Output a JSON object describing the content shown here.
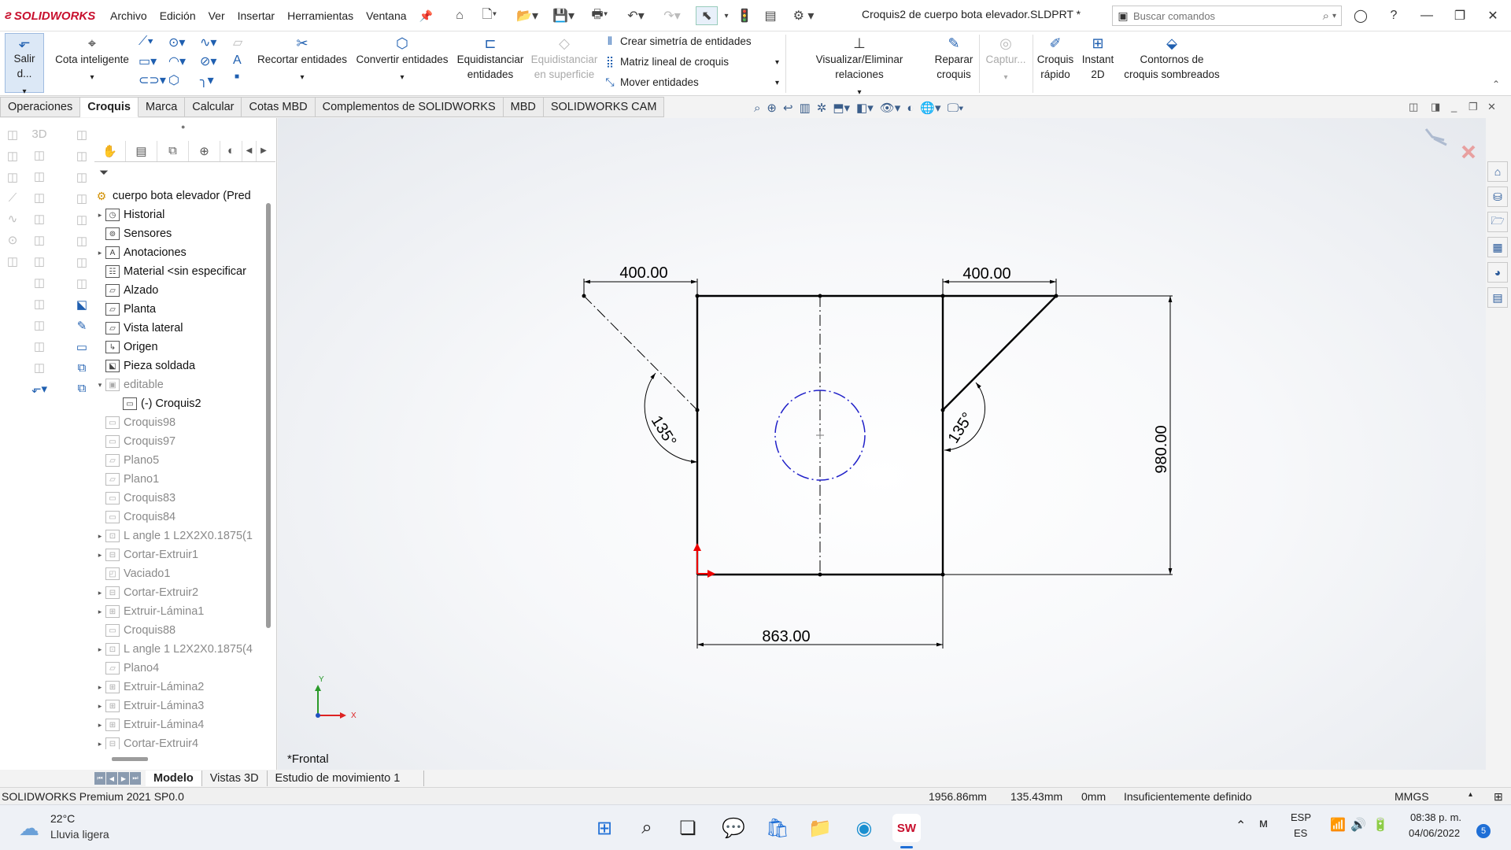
{
  "app": {
    "brand": "SOLIDWORKS",
    "title": "Croquis2 de cuerpo bota elevador.SLDPRT *"
  },
  "menu": [
    "Archivo",
    "Edición",
    "Ver",
    "Insertar",
    "Herramientas",
    "Ventana"
  ],
  "search": {
    "placeholder": "Buscar comandos"
  },
  "ribbon": {
    "exit_sketch": "Salir d...",
    "smart_dim": "Cota inteligente",
    "trim": "Recortar entidades",
    "convert": "Convertir entidades",
    "offset_1": "Equidistanciar",
    "offset_2": "entidades",
    "offset_surf_1": "Equidistanciar",
    "offset_surf_2": "en superficie",
    "mirror": "Crear simetría de entidades",
    "linear_pattern": "Matriz lineal de croquis",
    "move": "Mover entidades",
    "relations": "Visualizar/Eliminar relaciones",
    "repair_1": "Reparar",
    "repair_2": "croquis",
    "capture": "Captur...",
    "quick_1": "Croquis",
    "quick_2": "rápido",
    "instant_1": "Instant",
    "instant_2": "2D",
    "shaded_1": "Contornos de",
    "shaded_2": "croquis sombreados"
  },
  "tabs": [
    "Operaciones",
    "Croquis",
    "Marca",
    "Calcular",
    "Cotas MBD",
    "Complementos de SOLIDWORKS",
    "MBD",
    "SOLIDWORKS CAM"
  ],
  "tree": {
    "root": "cuerpo bota elevador  (Pred",
    "items": [
      {
        "label": "Historial",
        "arrow": true,
        "dim": false,
        "icon": "history-icon"
      },
      {
        "label": "Sensores",
        "arrow": false,
        "dim": false,
        "icon": "sensor-icon"
      },
      {
        "label": "Anotaciones",
        "arrow": true,
        "dim": false,
        "icon": "annotation-icon"
      },
      {
        "label": "Material <sin especificar",
        "arrow": false,
        "dim": false,
        "icon": "material-icon"
      },
      {
        "label": "Alzado",
        "arrow": false,
        "dim": false,
        "icon": "plane-icon"
      },
      {
        "label": "Planta",
        "arrow": false,
        "dim": false,
        "icon": "plane-icon"
      },
      {
        "label": "Vista lateral",
        "arrow": false,
        "dim": false,
        "icon": "plane-icon"
      },
      {
        "label": "Origen",
        "arrow": false,
        "dim": false,
        "icon": "origin-icon"
      },
      {
        "label": "Pieza soldada",
        "arrow": false,
        "dim": false,
        "icon": "weldment-icon"
      },
      {
        "label": "editable",
        "arrow": true,
        "dim": true,
        "icon": "folder-icon"
      },
      {
        "label": "(-) Croquis2",
        "arrow": false,
        "dim": false,
        "icon": "sketch-icon",
        "indent": true
      },
      {
        "label": "Croquis98",
        "arrow": false,
        "dim": true,
        "icon": "sketch-icon"
      },
      {
        "label": "Croquis97",
        "arrow": false,
        "dim": true,
        "icon": "sketch-icon"
      },
      {
        "label": "Plano5",
        "arrow": false,
        "dim": true,
        "icon": "plane-icon"
      },
      {
        "label": "Plano1",
        "arrow": false,
        "dim": true,
        "icon": "plane-icon"
      },
      {
        "label": "Croquis83",
        "arrow": false,
        "dim": true,
        "icon": "sketch-icon"
      },
      {
        "label": "Croquis84",
        "arrow": false,
        "dim": true,
        "icon": "sketch-icon"
      },
      {
        "label": "L angle 1 L2X2X0.1875(1",
        "arrow": true,
        "dim": true,
        "icon": "structure-icon"
      },
      {
        "label": "Cortar-Extruir1",
        "arrow": true,
        "dim": true,
        "icon": "cut-icon"
      },
      {
        "label": "Vaciado1",
        "arrow": false,
        "dim": true,
        "icon": "shell-icon"
      },
      {
        "label": "Cortar-Extruir2",
        "arrow": true,
        "dim": true,
        "icon": "cut-icon"
      },
      {
        "label": "Extruir-Lámina1",
        "arrow": true,
        "dim": true,
        "icon": "extrude-icon"
      },
      {
        "label": "Croquis88",
        "arrow": false,
        "dim": true,
        "icon": "sketch-icon"
      },
      {
        "label": "L angle 1 L2X2X0.1875(4",
        "arrow": true,
        "dim": true,
        "icon": "structure-icon"
      },
      {
        "label": "Plano4",
        "arrow": false,
        "dim": true,
        "icon": "plane-icon"
      },
      {
        "label": "Extruir-Lámina2",
        "arrow": true,
        "dim": true,
        "icon": "extrude-icon"
      },
      {
        "label": "Extruir-Lámina3",
        "arrow": true,
        "dim": true,
        "icon": "extrude-icon"
      },
      {
        "label": "Extruir-Lámina4",
        "arrow": true,
        "dim": true,
        "icon": "extrude-icon"
      },
      {
        "label": "Cortar-Extruir4",
        "arrow": true,
        "dim": true,
        "icon": "cut-icon"
      }
    ]
  },
  "sketch": {
    "dim_top_left": "400.00",
    "dim_top_right": "400.00",
    "dim_height": "980.00",
    "dim_bottom": "863.00",
    "angle_left": "135°",
    "angle_right": "135°",
    "axis_x": "X",
    "axis_y": "Y"
  },
  "view_name": "*Frontal",
  "bottom_tabs": [
    "Modelo",
    "Vistas 3D",
    "Estudio de movimiento 1"
  ],
  "status": {
    "version": "SOLIDWORKS Premium 2021 SP0.0",
    "x": "1956.86mm",
    "y": "135.43mm",
    "z": "0mm",
    "state": "Insuficientemente definido",
    "units": "MMGS"
  },
  "taskbar": {
    "temp": "22°C",
    "weather": "Lluvia ligera",
    "lang_1": "ESP",
    "lang_2": "ES",
    "time": "08:38 p. m.",
    "date": "04/06/2022",
    "notif": "5"
  },
  "colors": {
    "accent": "#1f5fb0",
    "brand": "#c8102e",
    "circle": "#2020c8"
  }
}
